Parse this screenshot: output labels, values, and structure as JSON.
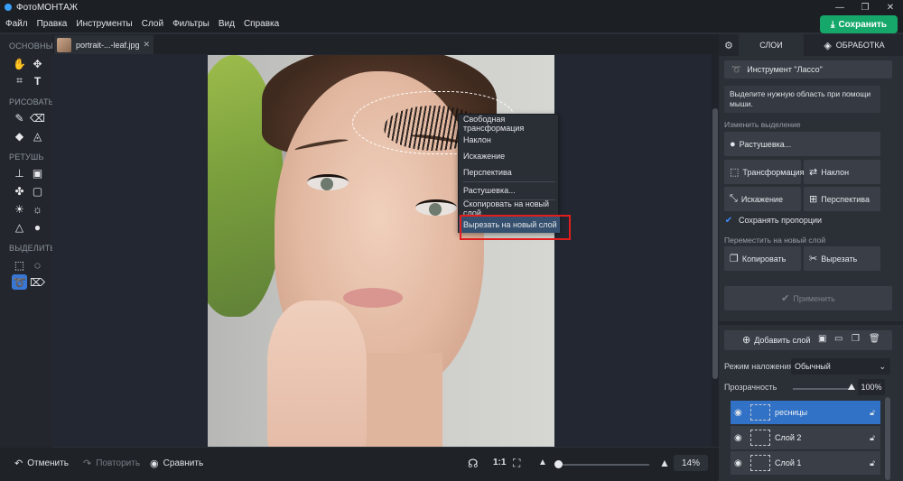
{
  "app": {
    "title": "ФотоМОНТАЖ"
  },
  "menu": [
    "Файл",
    "Правка",
    "Инструменты",
    "Слой",
    "Фильтры",
    "Вид",
    "Справка"
  ],
  "save_button": "Сохранить",
  "document": {
    "tab_name": "portrait-...-leaf.jpg"
  },
  "toolbar": {
    "sections": [
      "ОСНОВНЫЕ",
      "РИСОВАТЬ",
      "РЕТУШЬ",
      "ВЫДЕЛИТЬ"
    ],
    "active_tool": "lasso"
  },
  "context_menu": {
    "items": [
      "Свободная трансформация",
      "Наклон",
      "Искажение",
      "Перспектива",
      "Растушевка...",
      "Скопировать на новый слой",
      "Вырезать на новый слой"
    ],
    "highlighted_index": 6
  },
  "bottom": {
    "undo": "Отменить",
    "redo": "Повторить",
    "compare": "Сравнить",
    "fit_label": "1:1",
    "zoom": "14%"
  },
  "right_panel": {
    "tabs": [
      "СЛОИ",
      "ОБРАБОТКА"
    ],
    "tool_title": "Инструмент \"Лассо\"",
    "hint": "Выделите нужную область при помощи мыши.",
    "change_selection_label": "Изменить выделение",
    "feather_btn": "Растушевка...",
    "transform_btn": "Трансформация",
    "tilt_btn": "Наклон",
    "distort_btn": "Искажение",
    "perspective_btn": "Перспектива",
    "keep_proportions": "Сохранять пропорции",
    "move_to_layer_label": "Переместить на новый слой",
    "copy_btn": "Копировать",
    "cut_btn": "Вырезать",
    "apply_btn": "Применить",
    "add_layer": "Добавить слой",
    "blend_mode_label": "Режим наложения:",
    "blend_mode_value": "Обычный",
    "opacity_label": "Прозрачность",
    "opacity_value": "100%",
    "layers": [
      {
        "name": "ресницы",
        "selected": true
      },
      {
        "name": "Слой 2",
        "selected": false
      },
      {
        "name": "Слой 1",
        "selected": false
      }
    ]
  },
  "colors": {
    "accent": "#15a86a",
    "selection": "#3172c7",
    "highlight_box": "#e21d1d"
  }
}
